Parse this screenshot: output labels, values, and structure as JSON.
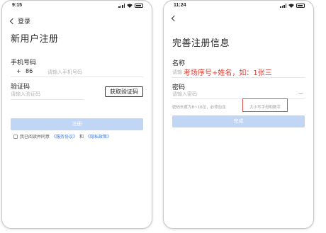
{
  "left": {
    "time": "9:15",
    "back_label": "登录",
    "title": "新用户注册",
    "phone_label": "手机号码",
    "plus": "+",
    "country_code": "86",
    "phone_placeholder": "请输入手机号码",
    "code_label": "验证码",
    "code_placeholder": "请输入验证码",
    "get_code_button": "获取验证码",
    "register_button": "注册",
    "agree_prefix": "我已阅读并同意",
    "service_link": "《服务协议》",
    "and": "和",
    "privacy_link": "《隐私政策》"
  },
  "right": {
    "time": "11:24",
    "title": "完善注册信息",
    "name_label": "名称",
    "name_placeholder": "请输",
    "annotation": "考场序号+姓名，如：1张三",
    "password_label": "密码",
    "password_placeholder": "请输入密码",
    "password_hint_a": "密码长度为8~16位，必须包含",
    "password_hint_b": "大小写字母和数字",
    "done_button": "完成"
  },
  "colors": {
    "button_disabled": "#c1d6f5",
    "link": "#3a7ae0",
    "annotation": "#e03c31"
  }
}
